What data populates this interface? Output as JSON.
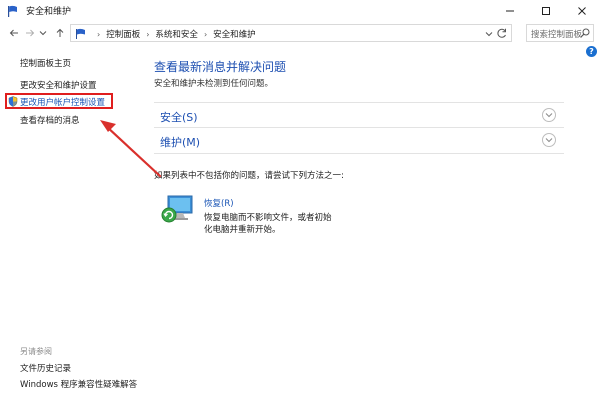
{
  "window": {
    "title": "安全和维护"
  },
  "navbar": {
    "breadcrumbs": [
      "控制面板",
      "系统和安全",
      "安全和维护"
    ],
    "search_placeholder": "搜索控制面板"
  },
  "sidebar": {
    "links": [
      {
        "label": "控制面板主页"
      },
      {
        "label": "更改安全和维护设置"
      },
      {
        "label": "更改用户帐户控制设置"
      },
      {
        "label": "查看存档的消息"
      }
    ],
    "see_also_label": "另请参阅",
    "see_also_links": [
      {
        "label": "文件历史记录"
      },
      {
        "label": "Windows 程序兼容性疑难解答"
      }
    ]
  },
  "main": {
    "title": "查看最新消息并解决问题",
    "subtitle": "安全和维护未检测到任何问题。",
    "sections": [
      {
        "label": "安全(S)"
      },
      {
        "label": "维护(M)"
      }
    ],
    "hint": "如果列表中不包括你的问题，请尝试下列方法之一:",
    "recovery": {
      "link": "恢复(R)",
      "desc_line1": "恢复电脑而不影响文件，或者初始",
      "desc_line2": "化电脑并重新开始。"
    }
  },
  "colors": {
    "accent_blue": "#1d4fb1",
    "link_blue": "#1a55b5",
    "highlight_red": "#e01e1e"
  }
}
